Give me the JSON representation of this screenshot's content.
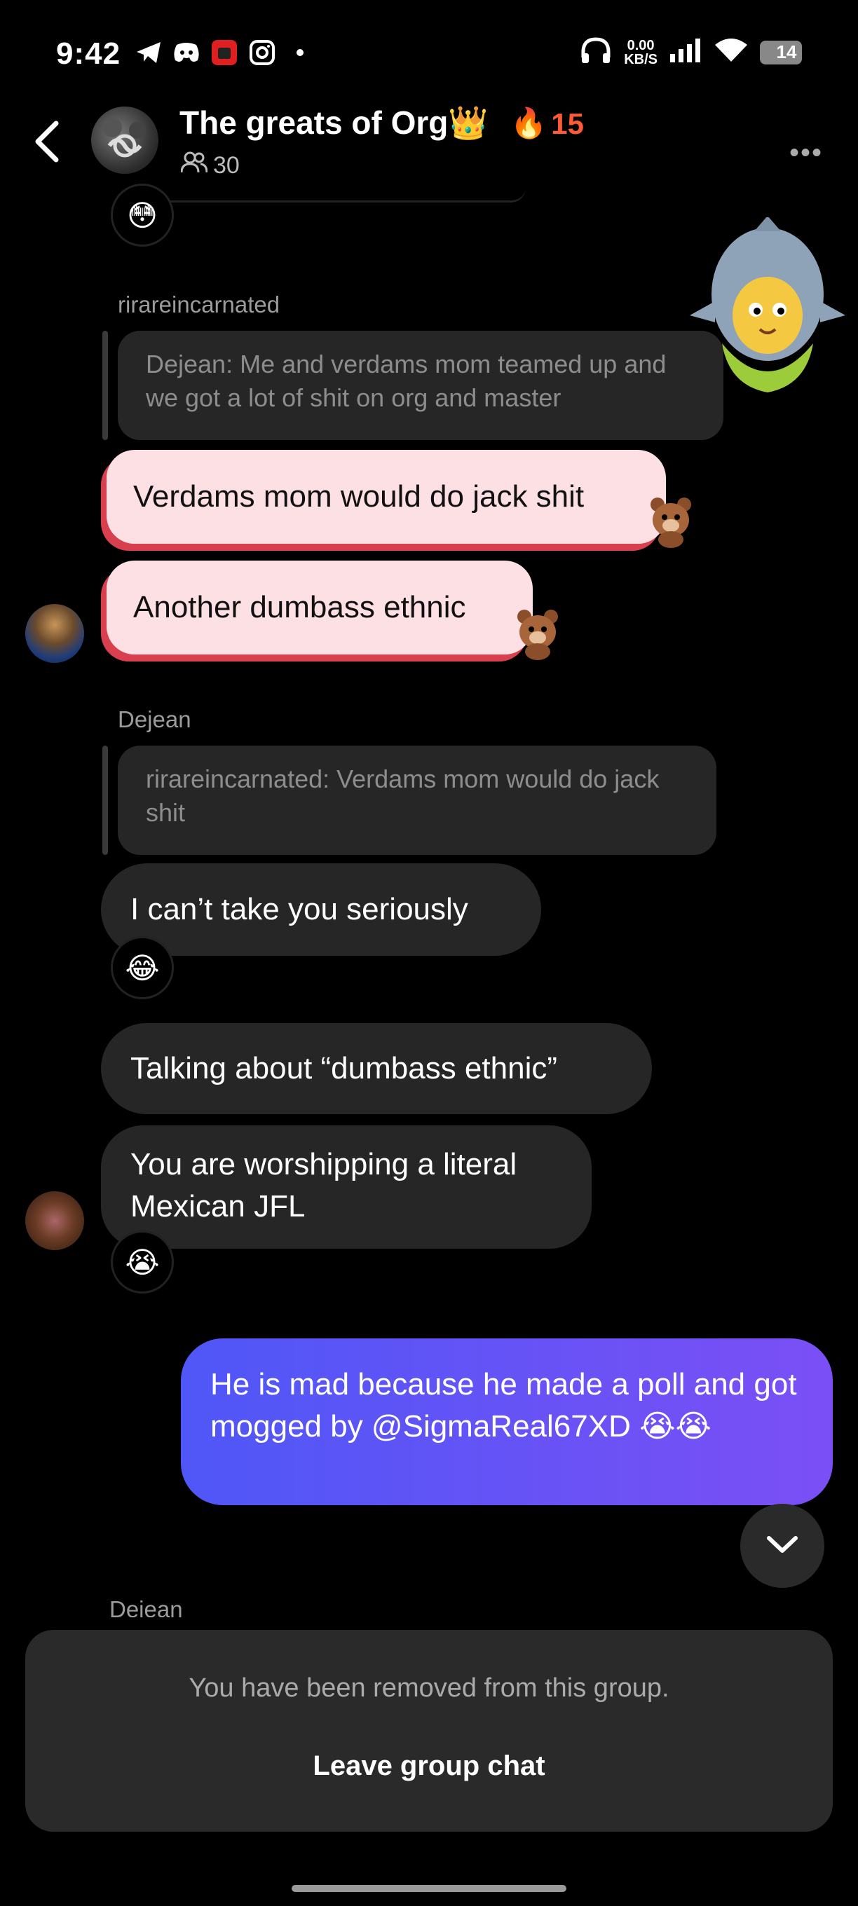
{
  "status_bar": {
    "time": "9:42",
    "net_speed_value": "0.00",
    "net_speed_unit": "KB/S",
    "battery": "14"
  },
  "header": {
    "title": "The greats of Org",
    "crown": "👑",
    "streak_icon": "🔥",
    "streak_count": "15",
    "member_count": "30",
    "more": "•••"
  },
  "messages": {
    "top_reaction": "😳",
    "m1": {
      "sender": "rirareincarnated",
      "reply_quote": "Dejean: Me and verdams mom teamed up and we got a lot of shit on org and master"
    },
    "m2": {
      "text": "Verdams mom would do jack shit"
    },
    "m3": {
      "text": "Another dumbass ethnic"
    },
    "m4": {
      "sender": "Dejean",
      "reply_quote": "rirareincarnated: Verdams mom would do jack shit"
    },
    "m5": {
      "text": "I can’t take you seriously",
      "reaction": "😂"
    },
    "m6": {
      "text": "Talking about “dumbass ethnic”"
    },
    "m7": {
      "text": "You are worshipping a literal Mexican JFL",
      "reaction": "😭"
    },
    "m8": {
      "text": "He is mad because he made a poll and got mogged by @SigmaReal67XD 😭😭"
    },
    "next_sender": "Dejean"
  },
  "removed_panel": {
    "message": "You have been removed from this group.",
    "leave_label": "Leave group chat"
  },
  "colors": {
    "outgoing_start": "#4f57f6",
    "outgoing_end": "#7b4ff5",
    "pink_bubble": "#fde0e4",
    "pink_shadow": "#d9404f",
    "streak": "#ff5a36"
  }
}
